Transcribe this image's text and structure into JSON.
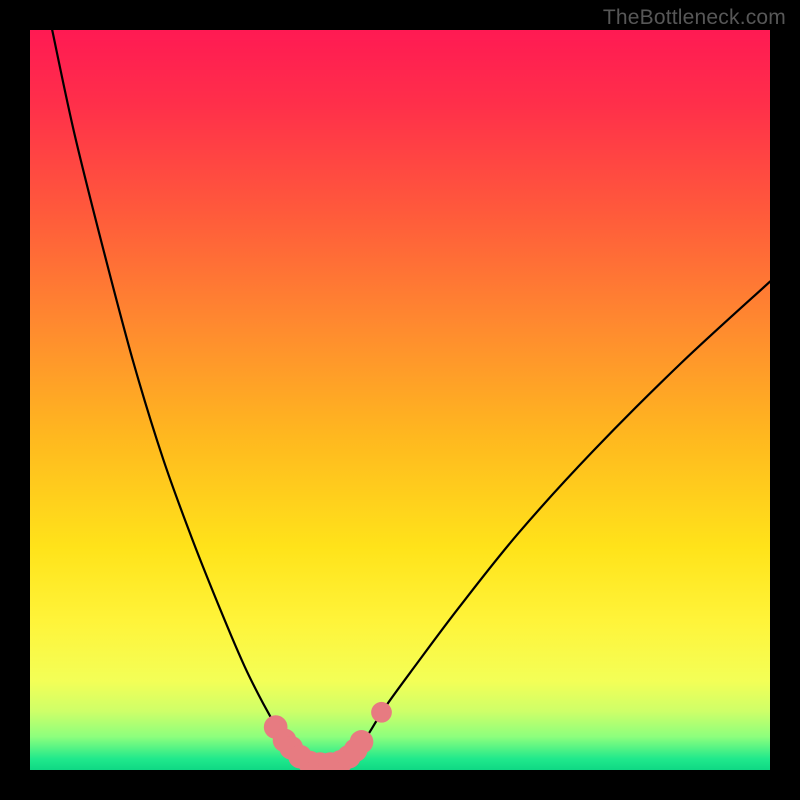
{
  "watermark": "TheBottleneck.com",
  "chart_data": {
    "type": "line",
    "title": "",
    "xlabel": "",
    "ylabel": "",
    "xlim": [
      0,
      100
    ],
    "ylim": [
      0,
      100
    ],
    "grid": false,
    "legend": false,
    "series": [
      {
        "name": "left-curve",
        "x": [
          3,
          6,
          10,
          14,
          18,
          22,
          26,
          29,
          31.5,
          33.5,
          35,
          36.2,
          37.2,
          38
        ],
        "values": [
          100,
          86,
          70,
          55,
          42,
          31,
          21,
          14,
          9,
          5.5,
          3.3,
          2,
          1.3,
          1
        ]
      },
      {
        "name": "right-curve",
        "x": [
          42,
          43.5,
          45.5,
          48,
          52,
          58,
          66,
          76,
          88,
          100
        ],
        "values": [
          1,
          2,
          4.5,
          8.5,
          14,
          22,
          32,
          43,
          55,
          66
        ]
      },
      {
        "name": "valley-floor",
        "x": [
          38,
          39.5,
          41,
          42
        ],
        "values": [
          1,
          0.8,
          0.8,
          1
        ]
      }
    ],
    "markers": {
      "name": "highlighted-points",
      "color": "#e77b81",
      "points": [
        {
          "x": 33.2,
          "y": 5.8,
          "r": 1.6
        },
        {
          "x": 34.4,
          "y": 4.0,
          "r": 1.6
        },
        {
          "x": 35.3,
          "y": 3.0,
          "r": 1.6
        },
        {
          "x": 36.5,
          "y": 1.8,
          "r": 1.6
        },
        {
          "x": 37.8,
          "y": 1.0,
          "r": 1.6
        },
        {
          "x": 39.2,
          "y": 0.8,
          "r": 1.6
        },
        {
          "x": 40.6,
          "y": 0.8,
          "r": 1.6
        },
        {
          "x": 42.0,
          "y": 1.1,
          "r": 1.6
        },
        {
          "x": 43.1,
          "y": 1.8,
          "r": 1.6
        },
        {
          "x": 44.0,
          "y": 2.7,
          "r": 1.6
        },
        {
          "x": 44.8,
          "y": 3.8,
          "r": 1.6
        },
        {
          "x": 47.5,
          "y": 7.8,
          "r": 1.4
        }
      ]
    },
    "background_gradient": {
      "stops": [
        {
          "offset": 0.0,
          "color": "#ff1a53"
        },
        {
          "offset": 0.1,
          "color": "#ff2f4a"
        },
        {
          "offset": 0.25,
          "color": "#ff5b3b"
        },
        {
          "offset": 0.4,
          "color": "#ff8a2f"
        },
        {
          "offset": 0.55,
          "color": "#ffb81f"
        },
        {
          "offset": 0.7,
          "color": "#ffe31a"
        },
        {
          "offset": 0.8,
          "color": "#fff43a"
        },
        {
          "offset": 0.88,
          "color": "#f3ff57"
        },
        {
          "offset": 0.92,
          "color": "#cfff68"
        },
        {
          "offset": 0.955,
          "color": "#8dff7d"
        },
        {
          "offset": 0.985,
          "color": "#20e98c"
        },
        {
          "offset": 1.0,
          "color": "#0fd884"
        }
      ]
    }
  }
}
